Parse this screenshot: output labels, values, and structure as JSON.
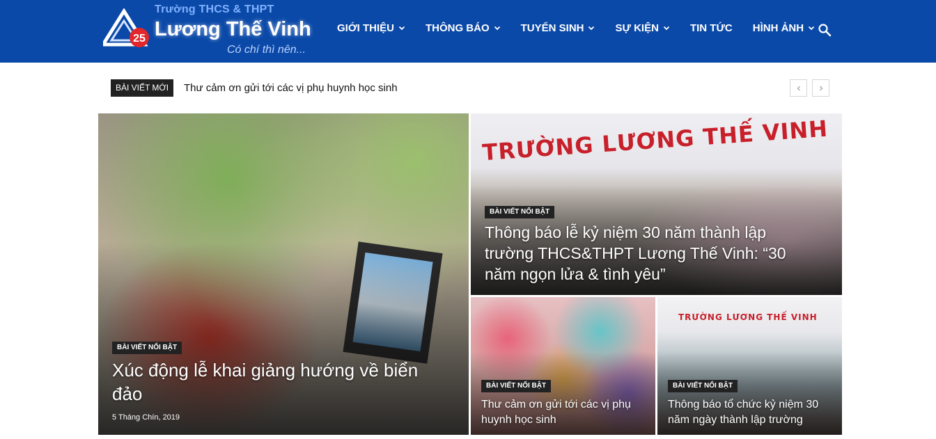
{
  "logo": {
    "top_line": "Trường THCS & THPT",
    "name": "Lương Thế Vinh",
    "badge_number": "25",
    "slogan": "Có chí thì nên..."
  },
  "nav": {
    "items": [
      {
        "label": "GIỚI THIỆU",
        "has_dropdown": true
      },
      {
        "label": "THÔNG BÁO",
        "has_dropdown": true
      },
      {
        "label": "TUYỂN SINH",
        "has_dropdown": true
      },
      {
        "label": "SỰ KIỆN",
        "has_dropdown": true
      },
      {
        "label": "TIN TỨC",
        "has_dropdown": false
      },
      {
        "label": "HÌNH ẢNH",
        "has_dropdown": true
      }
    ]
  },
  "ticker": {
    "label": "BÀI VIẾT MỚI",
    "headline": "Thư cảm ơn gửi tới các vị phụ huynh học sinh"
  },
  "featured": [
    {
      "badge": "BÀI VIẾT NỔI BẬT",
      "title": "Xúc động lễ khai giảng hướng về biển đảo",
      "date": "5 Tháng Chín, 2019"
    },
    {
      "badge": "BÀI VIẾT NỔI BẬT",
      "title": "Thông báo lễ kỷ niệm 30 năm thành lập trường THCS&THPT Lương Thế Vinh: “30 năm ngọn lửa & tình yêu”",
      "image_text": "TRƯỜNG LƯƠNG THẾ VINH"
    },
    {
      "badge": "BÀI VIẾT NỔI BẬT",
      "title": "Thư cảm ơn gửi tới các vị phụ huynh học sinh"
    },
    {
      "badge": "BÀI VIẾT NỔI BẬT",
      "title": "Thông báo tổ chức kỷ niệm 30 năm ngày thành lập trường",
      "image_text": "TRƯỜNG LƯƠNG THẾ VINH"
    }
  ],
  "colors": {
    "header_bg": "#0b49a8",
    "badge_bg": "#222222",
    "sign_red": "#c8202a"
  },
  "icons": {
    "search": "search-icon",
    "dropdown": "chevron-down-icon",
    "prev": "chevron-left-icon",
    "next": "chevron-right-icon"
  }
}
